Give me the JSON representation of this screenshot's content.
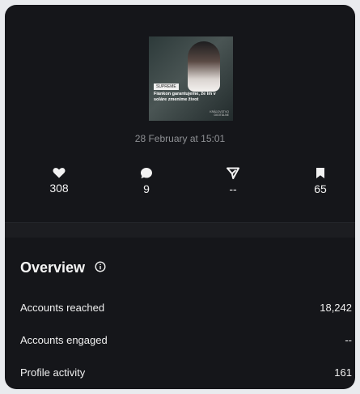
{
  "post": {
    "thumbnail": {
      "tag": "SUPREME",
      "caption": "Fiánkon garantujeme, že im v soláre zmeníme život",
      "credit": "KRÁĽOVSTVO DIGITÁLNE"
    },
    "date": "28 February at 15:01"
  },
  "stats": {
    "likes": {
      "icon": "heart-icon",
      "value": "308"
    },
    "comments": {
      "icon": "comment-bubble-icon",
      "value": "9"
    },
    "shares": {
      "icon": "send-arrow-icon",
      "value": "--"
    },
    "saves": {
      "icon": "bookmark-icon",
      "value": "65"
    }
  },
  "overview": {
    "title": "Overview",
    "rows": [
      {
        "label": "Accounts reached",
        "value": "18,242"
      },
      {
        "label": "Accounts engaged",
        "value": "--"
      },
      {
        "label": "Profile activity",
        "value": "161"
      }
    ]
  },
  "colors": {
    "card_bg": "#15161a",
    "text": "#f2f2f2",
    "muted": "#8e9094"
  }
}
